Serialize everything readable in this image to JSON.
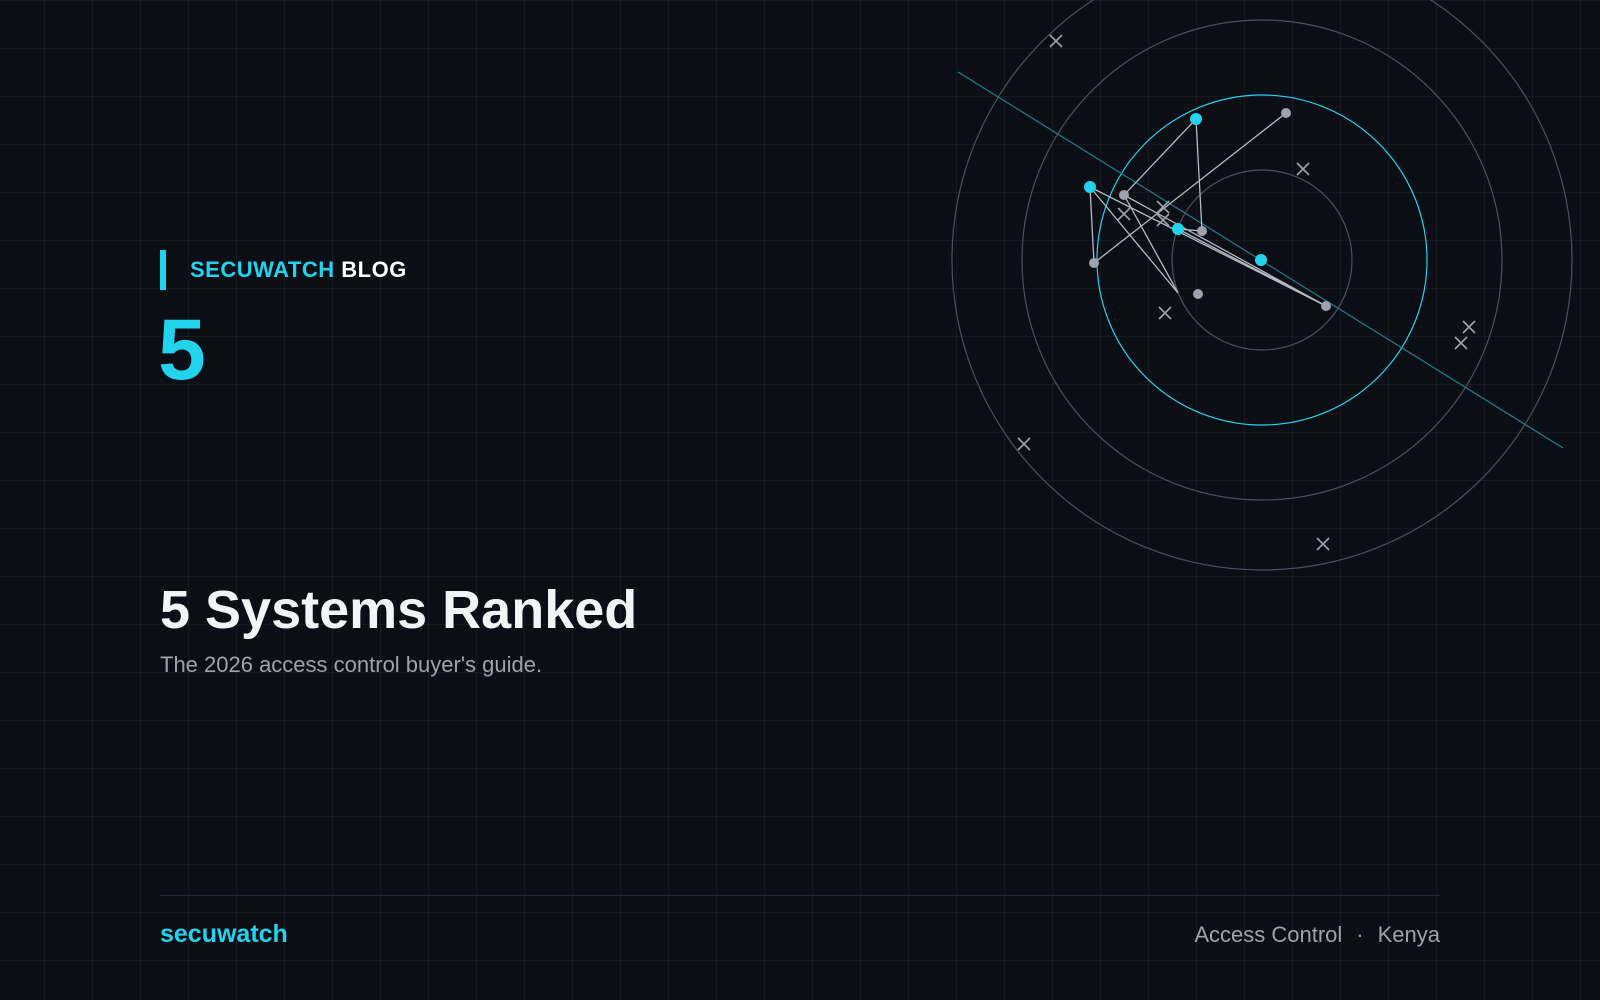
{
  "eyebrow": {
    "brand": "SECUWATCH",
    "section": "BLOG"
  },
  "hero": {
    "number": "5",
    "headline": "5 Systems Ranked",
    "subheadline": "The 2026 access control buyer's guide."
  },
  "footer": {
    "brand": "secuwatch",
    "category": "Access Control",
    "separator": "·",
    "location": "Kenya"
  },
  "colors": {
    "background": "#0b0e15",
    "accent": "#22d3ee",
    "heading": "#f3f4f6",
    "muted": "#9ca3af"
  }
}
